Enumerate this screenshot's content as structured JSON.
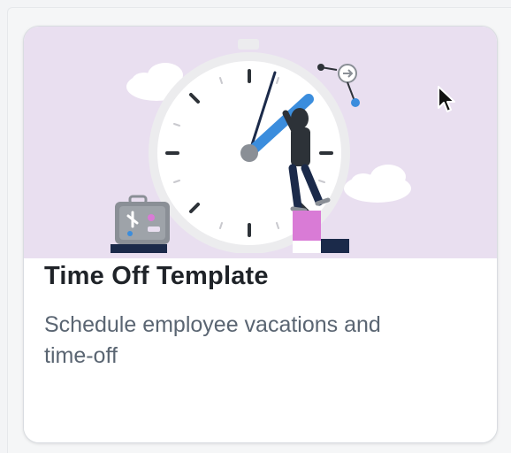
{
  "card": {
    "title": "Time Off Template",
    "description": "Schedule employee vacations and time-off"
  },
  "colors": {
    "illustration_background": "#e9dff0",
    "card_background": "#ffffff",
    "title_text": "#1f2328",
    "description_text": "#5a6572",
    "accent_blue": "#3b8ddd",
    "accent_pink": "#d97bd6",
    "navy": "#1b2a4a"
  },
  "icons": {
    "illustration": "clock-with-person-illustration",
    "cursor": "mouse-pointer-icon"
  }
}
